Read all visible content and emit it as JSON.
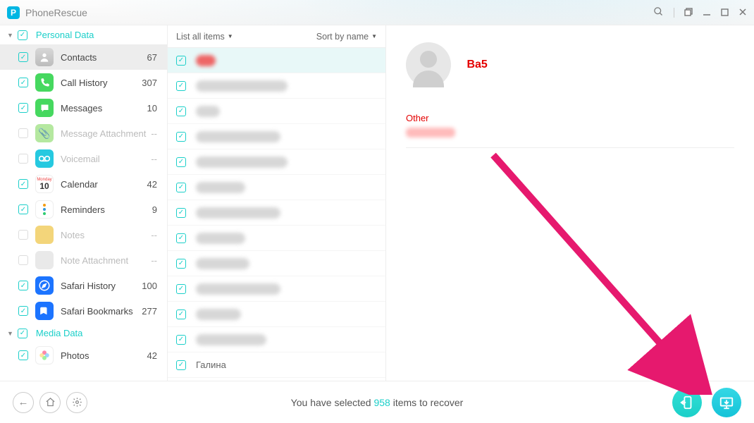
{
  "app": {
    "title": "PhoneRescue"
  },
  "sidebar": {
    "groups": [
      {
        "label": "Personal Data",
        "expanded": true,
        "checked": true,
        "items": [
          {
            "id": "contacts",
            "label": "Contacts",
            "count": "67",
            "checked": true,
            "selected": true,
            "disabled": false
          },
          {
            "id": "callhistory",
            "label": "Call History",
            "count": "307",
            "checked": true,
            "disabled": false
          },
          {
            "id": "messages",
            "label": "Messages",
            "count": "10",
            "checked": true,
            "disabled": false
          },
          {
            "id": "msgatt",
            "label": "Message Attachment",
            "count": "--",
            "checked": false,
            "disabled": true
          },
          {
            "id": "voicemail",
            "label": "Voicemail",
            "count": "--",
            "checked": false,
            "disabled": true
          },
          {
            "id": "calendar",
            "label": "Calendar",
            "count": "42",
            "checked": true,
            "disabled": false
          },
          {
            "id": "reminders",
            "label": "Reminders",
            "count": "9",
            "checked": true,
            "disabled": false
          },
          {
            "id": "notes",
            "label": "Notes",
            "count": "--",
            "checked": false,
            "disabled": true
          },
          {
            "id": "noteatt",
            "label": "Note Attachment",
            "count": "--",
            "checked": false,
            "disabled": true
          },
          {
            "id": "safarihist",
            "label": "Safari History",
            "count": "100",
            "checked": true,
            "disabled": false
          },
          {
            "id": "safaribook",
            "label": "Safari Bookmarks",
            "count": "277",
            "checked": true,
            "disabled": false
          }
        ]
      },
      {
        "label": "Media Data",
        "expanded": true,
        "checked": true,
        "items": [
          {
            "id": "photos",
            "label": "Photos",
            "count": "42",
            "checked": true,
            "disabled": false
          }
        ]
      }
    ]
  },
  "listpane": {
    "filter_label": "List all items",
    "sort_label": "Sort by name",
    "rows": [
      {
        "selected": true,
        "blur_w": 28
      },
      {
        "blur_w": 130
      },
      {
        "blur_w": 34
      },
      {
        "blur_w": 120
      },
      {
        "blur_w": 130
      },
      {
        "blur_w": 70
      },
      {
        "blur_w": 120
      },
      {
        "blur_w": 70
      },
      {
        "blur_w": 76
      },
      {
        "blur_w": 120
      },
      {
        "blur_w": 64
      },
      {
        "blur_w": 100
      },
      {
        "text": "Галина"
      }
    ]
  },
  "detail": {
    "name": "Ba5",
    "field_label": "Other"
  },
  "footer": {
    "prefix": "You have selected ",
    "count": "958",
    "suffix": " items to recover"
  },
  "icons": {
    "contacts": "ic-contacts",
    "callhistory": "ic-call",
    "messages": "ic-msg",
    "msgatt": "ic-att",
    "voicemail": "ic-vm",
    "calendar": "ic-cal",
    "reminders": "ic-rem",
    "notes": "ic-note",
    "noteatt": "ic-natt",
    "safarihist": "ic-safari",
    "safaribook": "ic-book",
    "photos": "ic-photo"
  }
}
